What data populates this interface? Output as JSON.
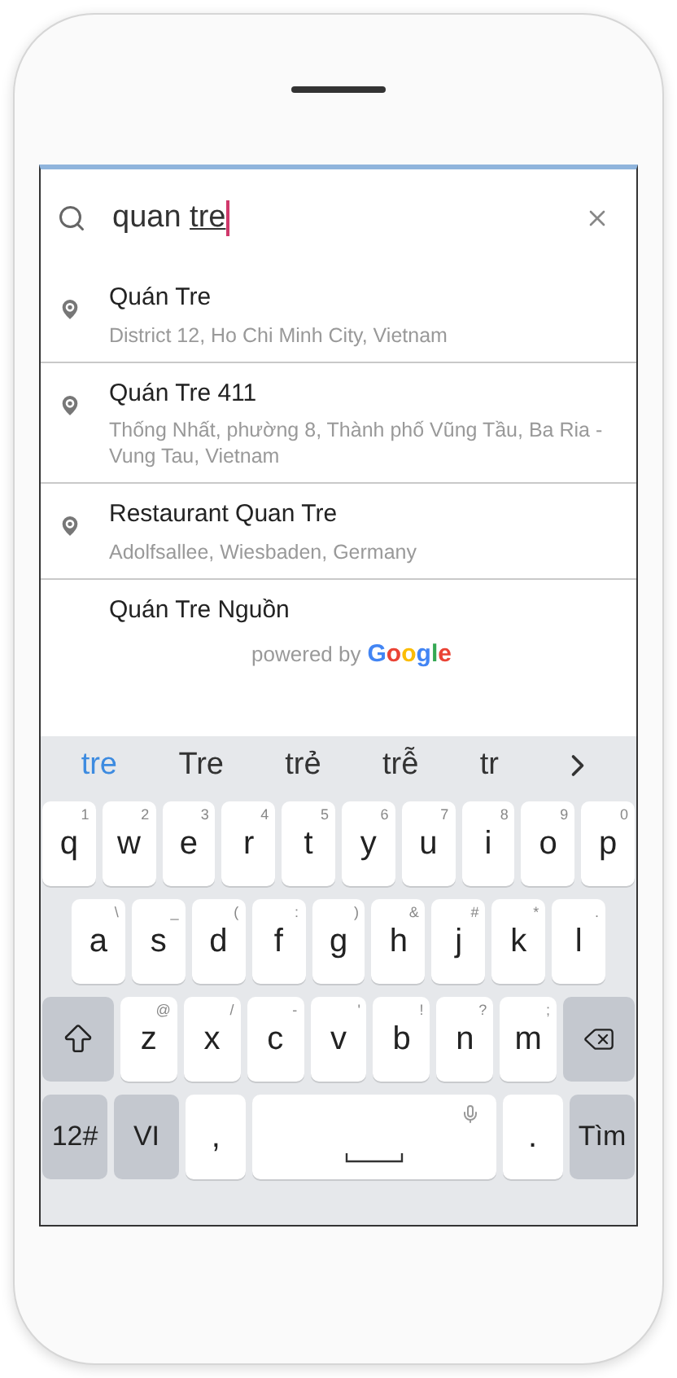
{
  "search": {
    "value": "quan ",
    "composing": "tre"
  },
  "results": [
    {
      "name": "Quán Tre",
      "address": "District 12, Ho Chi Minh City, Vietnam"
    },
    {
      "name": "Quán Tre 411",
      "address": "Thống Nhất, phường 8, Thành phố Vũng Tầu, Ba Ria - Vung Tau, Vietnam"
    },
    {
      "name": "Restaurant Quan Tre",
      "address": "Adolfsallee, Wiesbaden, Germany"
    },
    {
      "name": "Quán Tre Nguồn"
    }
  ],
  "attribution": {
    "prefix": "powered by",
    "brand": "Google"
  },
  "suggestions": [
    {
      "text": "tre",
      "selected": true
    },
    {
      "text": "Tre",
      "selected": false
    },
    {
      "text": "trẻ",
      "selected": false
    },
    {
      "text": "trễ",
      "selected": false
    },
    {
      "text": "tr",
      "selected": false
    }
  ],
  "keyboard": [
    [
      {
        "kind": "letter",
        "label": "q",
        "hint": "1"
      },
      {
        "kind": "letter",
        "label": "w",
        "hint": "2"
      },
      {
        "kind": "letter",
        "label": "e",
        "hint": "3"
      },
      {
        "kind": "letter",
        "label": "r",
        "hint": "4"
      },
      {
        "kind": "letter",
        "label": "t",
        "hint": "5"
      },
      {
        "kind": "letter",
        "label": "y",
        "hint": "6"
      },
      {
        "kind": "letter",
        "label": "u",
        "hint": "7"
      },
      {
        "kind": "letter",
        "label": "i",
        "hint": "8"
      },
      {
        "kind": "letter",
        "label": "o",
        "hint": "9"
      },
      {
        "kind": "letter",
        "label": "p",
        "hint": "0"
      }
    ],
    [
      {
        "kind": "letter",
        "label": "a",
        "hint": "\\"
      },
      {
        "kind": "letter",
        "label": "s",
        "hint": "_"
      },
      {
        "kind": "letter",
        "label": "d",
        "hint": "("
      },
      {
        "kind": "letter",
        "label": "f",
        "hint": ":"
      },
      {
        "kind": "letter",
        "label": "g",
        "hint": ")"
      },
      {
        "kind": "letter",
        "label": "h",
        "hint": "&"
      },
      {
        "kind": "letter",
        "label": "j",
        "hint": "#"
      },
      {
        "kind": "letter",
        "label": "k",
        "hint": "*"
      },
      {
        "kind": "letter",
        "label": "l",
        "hint": "."
      }
    ],
    [
      {
        "kind": "shift"
      },
      {
        "kind": "letter",
        "label": "z",
        "hint": "@"
      },
      {
        "kind": "letter",
        "label": "x",
        "hint": "/"
      },
      {
        "kind": "letter",
        "label": "c",
        "hint": "-"
      },
      {
        "kind": "letter",
        "label": "v",
        "hint": "'"
      },
      {
        "kind": "letter",
        "label": "b",
        "hint": "!"
      },
      {
        "kind": "letter",
        "label": "n",
        "hint": "?"
      },
      {
        "kind": "letter",
        "label": "m",
        "hint": ";"
      },
      {
        "kind": "backspace"
      }
    ],
    [
      {
        "kind": "function",
        "label": "12#"
      },
      {
        "kind": "function",
        "label": "VI"
      },
      {
        "kind": "letter",
        "label": ","
      },
      {
        "kind": "space"
      },
      {
        "kind": "letter",
        "label": "."
      },
      {
        "kind": "function",
        "label": "Tìm"
      }
    ]
  ]
}
